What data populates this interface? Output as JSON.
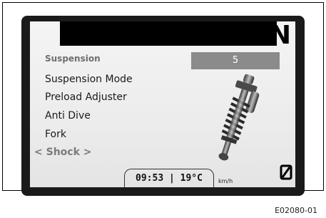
{
  "display": {
    "gear": "N",
    "menu_title": "Suspension",
    "value": "5",
    "menu_items": [
      "Suspension Mode",
      "Preload Adjuster",
      "Anti Dive",
      "Fork",
      "< Shock >"
    ],
    "clock": "09:53",
    "temperature": "19°C",
    "speed_unit": "km/h",
    "trip_icon": "slashed-zero-icon"
  },
  "figure": {
    "id": "E02080-01"
  }
}
